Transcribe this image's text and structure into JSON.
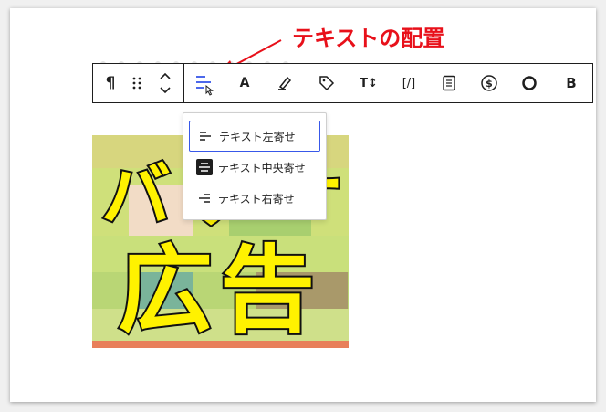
{
  "callout": {
    "text": "テキストの配置"
  },
  "colors": {
    "accent": "#3858e9",
    "callout": "#e8101a",
    "image_text": "#fff200"
  },
  "toolbar": {
    "buttons": [
      {
        "name": "paragraph-button",
        "icon": "pilcrow-icon"
      },
      {
        "name": "drag-handle",
        "icon": "drag-dots-icon"
      },
      {
        "name": "move-up-down-button",
        "icon": "chevron-up-down-icon"
      },
      {
        "name": "text-align-button",
        "icon": "align-left-icon"
      },
      {
        "name": "text-color-button",
        "icon": "letter-a-icon",
        "label": "A"
      },
      {
        "name": "highlight-button",
        "icon": "pen-icon"
      },
      {
        "name": "tag-button",
        "icon": "tag-icon"
      },
      {
        "name": "font-size-button",
        "icon": "text-size-icon",
        "label": "T↕"
      },
      {
        "name": "code-button",
        "icon": "brackets-icon",
        "label": "[/]"
      },
      {
        "name": "document-button",
        "icon": "document-icon"
      },
      {
        "name": "dollar-button",
        "icon": "dollar-circle-icon",
        "label": "$"
      },
      {
        "name": "circle-button",
        "icon": "circle-icon"
      },
      {
        "name": "bold-button",
        "icon": "bold-icon",
        "label": "B"
      }
    ]
  },
  "dropdown": {
    "items": [
      {
        "label": "テキスト左寄せ",
        "icon": "align-left-icon",
        "selected": true
      },
      {
        "label": "テキスト中央寄せ",
        "icon": "align-center-icon",
        "selected": false
      },
      {
        "label": "テキスト右寄せ",
        "icon": "align-right-icon",
        "selected": false
      }
    ]
  },
  "image": {
    "line1": "バ",
    "line1b": "ナ",
    "line1c": "ー",
    "line2": "広告"
  }
}
